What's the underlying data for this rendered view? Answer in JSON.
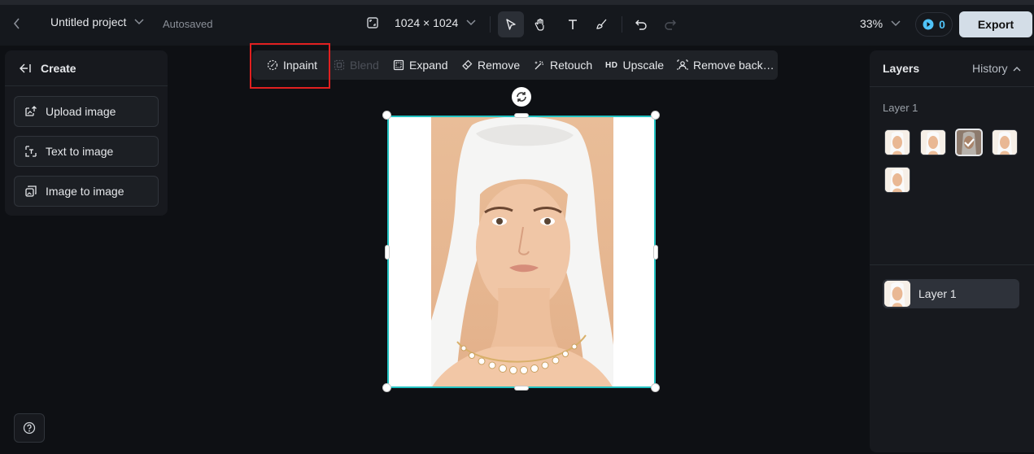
{
  "header": {
    "project_name": "Untitled project",
    "autosave_status": "Autosaved",
    "canvas_size": "1024 × 1024",
    "zoom": "33%",
    "credits": "0",
    "export_label": "Export"
  },
  "create_panel": {
    "title": "Create",
    "buttons": [
      {
        "label": "Upload image",
        "icon": "upload-image-icon"
      },
      {
        "label": "Text to image",
        "icon": "text-to-image-icon"
      },
      {
        "label": "Image to image",
        "icon": "image-to-image-icon"
      }
    ]
  },
  "edit_toolbar": {
    "items": [
      {
        "label": "Inpaint",
        "icon": "brush-icon",
        "enabled": true
      },
      {
        "label": "Blend",
        "icon": "blend-icon",
        "enabled": false
      },
      {
        "label": "Expand",
        "icon": "expand-icon",
        "enabled": true
      },
      {
        "label": "Remove",
        "icon": "eraser-icon",
        "enabled": true
      },
      {
        "label": "Retouch",
        "icon": "magic-wand-icon",
        "enabled": true
      },
      {
        "label": "Upscale",
        "icon": "hd-badge",
        "badge_text": "HD",
        "enabled": true
      },
      {
        "label": "Remove back…",
        "icon": "remove-background-icon",
        "enabled": true
      }
    ]
  },
  "layers_panel": {
    "tab_layers": "Layers",
    "tab_history": "History",
    "group_label": "Layer 1",
    "thumbnails_count": 5,
    "selected_thumbnail": 3,
    "layer_row_label": "Layer 1"
  },
  "colors": {
    "accent_selection": "#23c2c2",
    "highlight_box": "#e02020",
    "export_bg": "#d3dde7",
    "credits_accent": "#4fc3f7"
  }
}
